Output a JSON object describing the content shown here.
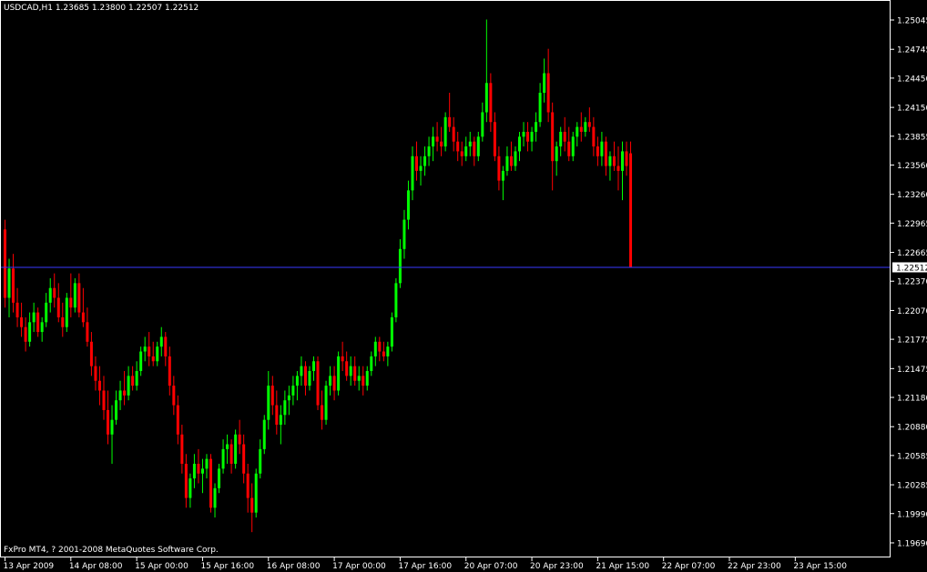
{
  "header": {
    "text": "USDCAD,H1  1.23685 1.23800 1.22507 1.22512"
  },
  "footer": {
    "text": "FxPro MT4, ? 2001-2008 MetaQuotes Software Corp."
  },
  "colors": {
    "background": "#000000",
    "frame": "#ffffff",
    "bull": "#00ff00",
    "bear": "#ff0000",
    "price_line": "#3a3aff",
    "text": "#ffffff"
  },
  "chart_data": {
    "type": "candlestick",
    "symbol": "USDCAD",
    "timeframe": "H1",
    "last_bar": {
      "open": 1.23685,
      "high": 1.238,
      "low": 1.22507,
      "close": 1.22512
    },
    "current_price": "1.22512",
    "ylim": [
      1.1955,
      1.2525
    ],
    "y_ticks": [
      "1.25045",
      "1.24745",
      "1.24450",
      "1.24150",
      "1.23855",
      "1.23560",
      "1.23260",
      "1.22965",
      "1.22665",
      "1.22370",
      "1.22070",
      "1.21775",
      "1.21475",
      "1.21180",
      "1.20880",
      "1.20585",
      "1.20285",
      "1.19990",
      "1.19690"
    ],
    "x_ticks": [
      "13 Apr 2009",
      "14 Apr 08:00",
      "15 Apr 00:00",
      "15 Apr 16:00",
      "16 Apr 08:00",
      "17 Apr 00:00",
      "17 Apr 16:00",
      "20 Apr 07:00",
      "20 Apr 23:00",
      "21 Apr 15:00",
      "22 Apr 07:00",
      "22 Apr 23:00",
      "23 Apr 15:00"
    ],
    "bars": [
      [
        1.229,
        1.23,
        1.221,
        1.222
      ],
      [
        1.222,
        1.226,
        1.22,
        1.225
      ],
      [
        1.225,
        1.2265,
        1.2205,
        1.2215
      ],
      [
        1.2215,
        1.223,
        1.219,
        1.22
      ],
      [
        1.22,
        1.2215,
        1.218,
        1.219
      ],
      [
        1.219,
        1.22,
        1.2165,
        1.2175
      ],
      [
        1.2175,
        1.2205,
        1.217,
        1.2195
      ],
      [
        1.2195,
        1.2215,
        1.2185,
        1.2205
      ],
      [
        1.2205,
        1.221,
        1.218,
        1.2185
      ],
      [
        1.2185,
        1.22,
        1.2175,
        1.2195
      ],
      [
        1.2195,
        1.2225,
        1.219,
        1.2215
      ],
      [
        1.2215,
        1.224,
        1.2205,
        1.223
      ],
      [
        1.223,
        1.2245,
        1.221,
        1.222
      ],
      [
        1.222,
        1.2235,
        1.2195,
        1.22
      ],
      [
        1.22,
        1.2215,
        1.218,
        1.219
      ],
      [
        1.219,
        1.2225,
        1.2185,
        1.222
      ],
      [
        1.222,
        1.2245,
        1.22,
        1.221
      ],
      [
        1.221,
        1.224,
        1.2205,
        1.2235
      ],
      [
        1.2235,
        1.2245,
        1.22,
        1.2205
      ],
      [
        1.2205,
        1.223,
        1.219,
        1.2195
      ],
      [
        1.2195,
        1.221,
        1.217,
        1.2175
      ],
      [
        1.2175,
        1.2185,
        1.214,
        1.215
      ],
      [
        1.215,
        1.216,
        1.2125,
        1.2135
      ],
      [
        1.2135,
        1.215,
        1.211,
        1.2125
      ],
      [
        1.2125,
        1.214,
        1.2095,
        1.2105
      ],
      [
        1.2105,
        1.2125,
        1.207,
        1.208
      ],
      [
        1.208,
        1.211,
        1.205,
        1.2095
      ],
      [
        1.2095,
        1.2125,
        1.209,
        1.2115
      ],
      [
        1.2115,
        1.2135,
        1.2105,
        1.2125
      ],
      [
        1.2125,
        1.2145,
        1.211,
        1.212
      ],
      [
        1.212,
        1.215,
        1.2115,
        1.214
      ],
      [
        1.214,
        1.215,
        1.2125,
        1.213
      ],
      [
        1.213,
        1.2155,
        1.2125,
        1.2145
      ],
      [
        1.2145,
        1.217,
        1.214,
        1.2165
      ],
      [
        1.2165,
        1.218,
        1.2155,
        1.217
      ],
      [
        1.217,
        1.2185,
        1.215,
        1.216
      ],
      [
        1.216,
        1.2175,
        1.215,
        1.2155
      ],
      [
        1.2155,
        1.2175,
        1.215,
        1.217
      ],
      [
        1.217,
        1.219,
        1.216,
        1.218
      ],
      [
        1.218,
        1.2185,
        1.215,
        1.216
      ],
      [
        1.216,
        1.217,
        1.212,
        1.213
      ],
      [
        1.213,
        1.214,
        1.21,
        1.211
      ],
      [
        1.211,
        1.212,
        1.207,
        1.208
      ],
      [
        1.208,
        1.209,
        1.204,
        1.205
      ],
      [
        1.205,
        1.206,
        1.2005,
        1.2015
      ],
      [
        1.2015,
        1.204,
        1.2005,
        1.2035
      ],
      [
        1.2035,
        1.206,
        1.2025,
        1.205
      ],
      [
        1.205,
        1.2065,
        1.203,
        1.204
      ],
      [
        1.204,
        1.2055,
        1.202,
        1.2045
      ],
      [
        1.2045,
        1.206,
        1.2035,
        1.2055
      ],
      [
        1.2055,
        1.206,
        1.2,
        1.2005
      ],
      [
        1.2005,
        1.203,
        1.1995,
        1.2025
      ],
      [
        1.2025,
        1.205,
        1.202,
        1.2045
      ],
      [
        1.2045,
        1.2075,
        1.204,
        1.2065
      ],
      [
        1.2065,
        1.208,
        1.205,
        1.207
      ],
      [
        1.207,
        1.2075,
        1.204,
        1.205
      ],
      [
        1.205,
        1.2085,
        1.2045,
        1.208
      ],
      [
        1.208,
        1.2095,
        1.206,
        1.207
      ],
      [
        1.207,
        1.208,
        1.203,
        1.204
      ],
      [
        1.204,
        1.205,
        1.2,
        1.2015
      ],
      [
        1.2015,
        1.203,
        1.198,
        1.2
      ],
      [
        1.2,
        1.2045,
        1.1995,
        1.204
      ],
      [
        1.204,
        1.2075,
        1.2035,
        1.2065
      ],
      [
        1.2065,
        1.21,
        1.206,
        1.2095
      ],
      [
        1.2095,
        1.2145,
        1.2085,
        1.213
      ],
      [
        1.213,
        1.214,
        1.21,
        1.211
      ],
      [
        1.211,
        1.2125,
        1.208,
        1.209
      ],
      [
        1.209,
        1.211,
        1.207,
        1.21
      ],
      [
        1.21,
        1.2125,
        1.209,
        1.2115
      ],
      [
        1.2115,
        1.213,
        1.21,
        1.212
      ],
      [
        1.212,
        1.214,
        1.211,
        1.213
      ],
      [
        1.213,
        1.2145,
        1.2115,
        1.214
      ],
      [
        1.214,
        1.216,
        1.213,
        1.215
      ],
      [
        1.215,
        1.2155,
        1.212,
        1.213
      ],
      [
        1.213,
        1.215,
        1.2125,
        1.2145
      ],
      [
        1.2145,
        1.216,
        1.2135,
        1.2155
      ],
      [
        1.2155,
        1.216,
        1.2105,
        1.211
      ],
      [
        1.211,
        1.2125,
        1.2085,
        1.2095
      ],
      [
        1.2095,
        1.2135,
        1.209,
        1.213
      ],
      [
        1.213,
        1.215,
        1.212,
        1.214
      ],
      [
        1.214,
        1.215,
        1.2115,
        1.2125
      ],
      [
        1.2125,
        1.2165,
        1.212,
        1.216
      ],
      [
        1.216,
        1.2175,
        1.2145,
        1.2155
      ],
      [
        1.2155,
        1.2165,
        1.2135,
        1.214
      ],
      [
        1.214,
        1.216,
        1.213,
        1.215
      ],
      [
        1.215,
        1.216,
        1.213,
        1.2135
      ],
      [
        1.2135,
        1.215,
        1.2125,
        1.214
      ],
      [
        1.214,
        1.215,
        1.212,
        1.213
      ],
      [
        1.213,
        1.215,
        1.2125,
        1.2145
      ],
      [
        1.2145,
        1.2165,
        1.214,
        1.216
      ],
      [
        1.216,
        1.218,
        1.215,
        1.2175
      ],
      [
        1.2175,
        1.218,
        1.2155,
        1.2165
      ],
      [
        1.2165,
        1.2175,
        1.2155,
        1.216
      ],
      [
        1.216,
        1.2175,
        1.215,
        1.217
      ],
      [
        1.217,
        1.2205,
        1.2165,
        1.22
      ],
      [
        1.22,
        1.224,
        1.2195,
        1.2235
      ],
      [
        1.2235,
        1.228,
        1.223,
        1.227
      ],
      [
        1.227,
        1.231,
        1.226,
        1.23
      ],
      [
        1.23,
        1.234,
        1.229,
        1.233
      ],
      [
        1.233,
        1.2375,
        1.232,
        1.2365
      ],
      [
        1.2365,
        1.238,
        1.234,
        1.235
      ],
      [
        1.235,
        1.2365,
        1.2335,
        1.2355
      ],
      [
        1.2355,
        1.2375,
        1.2345,
        1.2365
      ],
      [
        1.2365,
        1.2385,
        1.2355,
        1.2375
      ],
      [
        1.2375,
        1.2395,
        1.236,
        1.2385
      ],
      [
        1.2385,
        1.24,
        1.237,
        1.238
      ],
      [
        1.238,
        1.2395,
        1.2365,
        1.2375
      ],
      [
        1.2375,
        1.241,
        1.237,
        1.2405
      ],
      [
        1.2405,
        1.243,
        1.239,
        1.2395
      ],
      [
        1.2395,
        1.2405,
        1.237,
        1.238
      ],
      [
        1.238,
        1.239,
        1.236,
        1.237
      ],
      [
        1.237,
        1.238,
        1.2355,
        1.2365
      ],
      [
        1.2365,
        1.2385,
        1.236,
        1.2375
      ],
      [
        1.2375,
        1.239,
        1.2365,
        1.238
      ],
      [
        1.238,
        1.2385,
        1.2355,
        1.2365
      ],
      [
        1.2365,
        1.239,
        1.236,
        1.2385
      ],
      [
        1.2385,
        1.242,
        1.238,
        1.241
      ],
      [
        1.241,
        1.2505,
        1.24,
        1.244
      ],
      [
        1.244,
        1.245,
        1.239,
        1.24
      ],
      [
        1.24,
        1.241,
        1.236,
        1.2365
      ],
      [
        1.2365,
        1.2375,
        1.233,
        1.234
      ],
      [
        1.234,
        1.2355,
        1.232,
        1.235
      ],
      [
        1.235,
        1.2375,
        1.2345,
        1.2365
      ],
      [
        1.2365,
        1.238,
        1.235,
        1.2355
      ],
      [
        1.2355,
        1.2375,
        1.235,
        1.237
      ],
      [
        1.237,
        1.239,
        1.236,
        1.2385
      ],
      [
        1.2385,
        1.24,
        1.2375,
        1.239
      ],
      [
        1.239,
        1.24,
        1.237,
        1.238
      ],
      [
        1.238,
        1.2395,
        1.237,
        1.239
      ],
      [
        1.239,
        1.241,
        1.238,
        1.24
      ],
      [
        1.24,
        1.244,
        1.2395,
        1.243
      ],
      [
        1.243,
        1.2465,
        1.242,
        1.245
      ],
      [
        1.245,
        1.2475,
        1.24,
        1.241
      ],
      [
        1.241,
        1.242,
        1.233,
        1.236
      ],
      [
        1.236,
        1.238,
        1.2345,
        1.2375
      ],
      [
        1.2375,
        1.2395,
        1.2365,
        1.239
      ],
      [
        1.239,
        1.2405,
        1.237,
        1.238
      ],
      [
        1.238,
        1.2395,
        1.236,
        1.2365
      ],
      [
        1.2365,
        1.239,
        1.236,
        1.2385
      ],
      [
        1.2385,
        1.24,
        1.2375,
        1.2395
      ],
      [
        1.2395,
        1.241,
        1.238,
        1.239
      ],
      [
        1.239,
        1.2405,
        1.2385,
        1.24
      ],
      [
        1.24,
        1.2415,
        1.239,
        1.2395
      ],
      [
        1.2395,
        1.2405,
        1.2365,
        1.2375
      ],
      [
        1.2375,
        1.2385,
        1.2355,
        1.2365
      ],
      [
        1.2365,
        1.239,
        1.2355,
        1.238
      ],
      [
        1.238,
        1.2385,
        1.2345,
        1.2355
      ],
      [
        1.2355,
        1.237,
        1.234,
        1.2365
      ],
      [
        1.2365,
        1.238,
        1.235,
        1.2355
      ],
      [
        1.2355,
        1.2375,
        1.233,
        1.235
      ],
      [
        1.235,
        1.238,
        1.232,
        1.237
      ],
      [
        1.237,
        1.238,
        1.2345,
        1.2355
      ],
      [
        1.2368,
        1.238,
        1.2251,
        1.2251
      ]
    ]
  }
}
